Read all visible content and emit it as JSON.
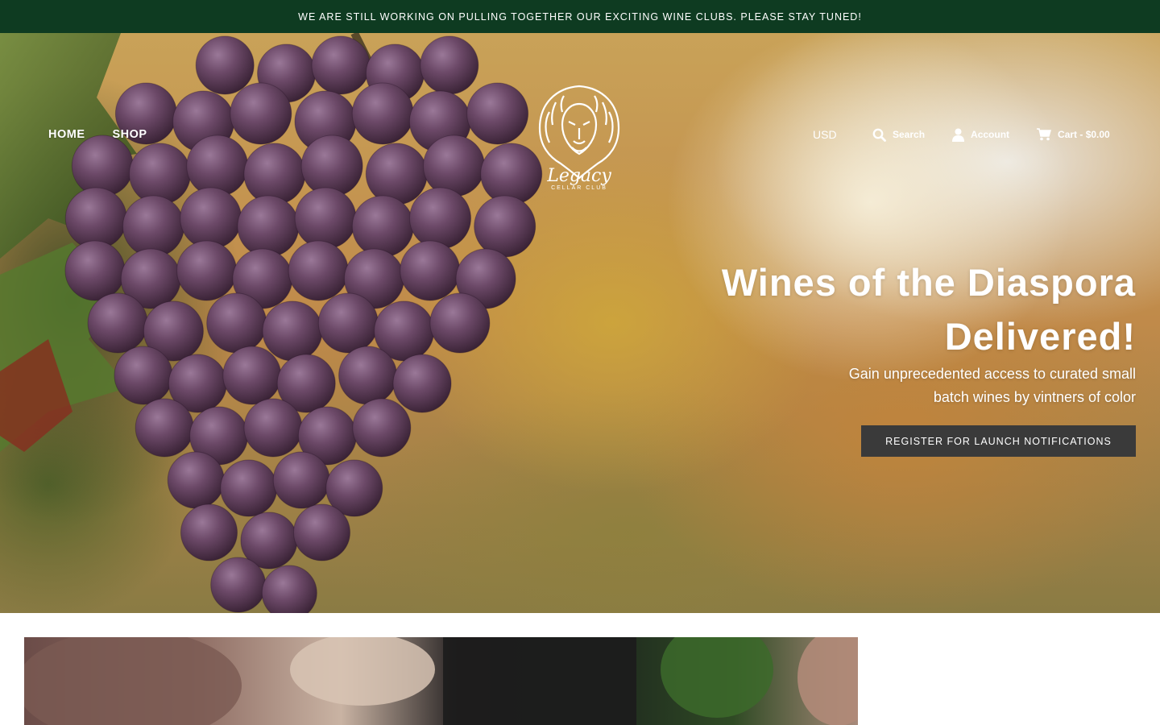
{
  "announcement": {
    "text": "WE ARE STILL WORKING ON PULLING TOGETHER OUR EXCITING WINE CLUBS. PLEASE STAY TUNED!"
  },
  "header": {
    "nav": [
      {
        "label": "HOME"
      },
      {
        "label": "SHOP"
      }
    ],
    "logo": {
      "icon": "lion-crest-logo",
      "script_text": "Legacy",
      "sub_text": "CELLAR CLUB"
    },
    "currency": "USD",
    "search": {
      "label": "Search",
      "icon": "search-icon"
    },
    "account": {
      "label": "Account",
      "icon": "user-icon"
    },
    "cart": {
      "label": "Cart - $0.00",
      "icon": "cart-icon"
    }
  },
  "hero": {
    "headline": "Wines of the Diaspora Delivered!",
    "subtext": "Gain unprecedented access to curated small batch wines by vintners of color",
    "cta_label": "REGISTER FOR LAUNCH NOTIFICATIONS",
    "image": "grape-vineyard-photo"
  },
  "section": {
    "image": "friends-toasting-wine-photo"
  },
  "colors": {
    "announcement_bg": "#0e3b21",
    "cta_bg": "#3a3a3a",
    "text_light": "#ffffff"
  }
}
